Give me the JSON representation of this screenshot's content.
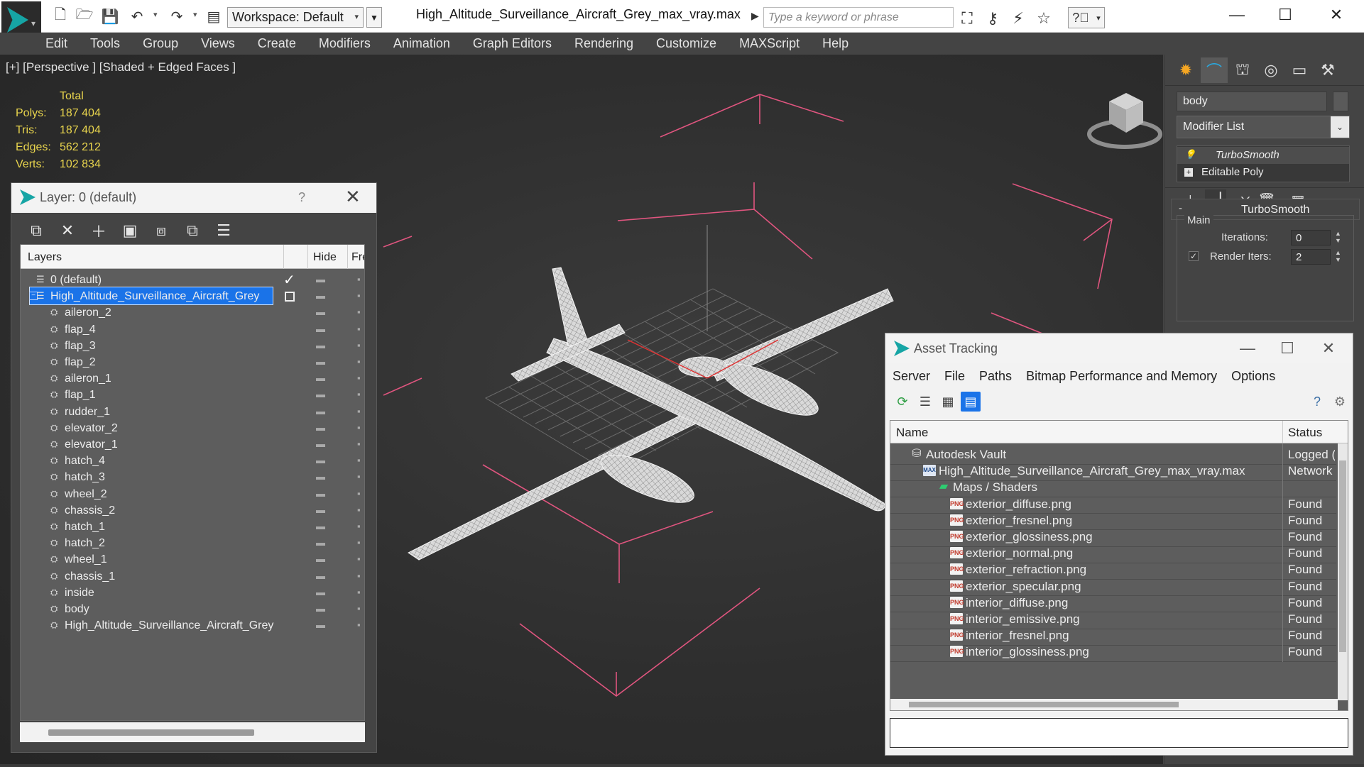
{
  "titlebar": {
    "workspace": "Workspace: Default",
    "file_title": "High_Altitude_Surveillance_Aircraft_Grey_max_vray.max",
    "search_placeholder": "Type a keyword or phrase",
    "minimize": "—",
    "maximize": "☐",
    "close": "✕"
  },
  "menubar": [
    "Edit",
    "Tools",
    "Group",
    "Views",
    "Create",
    "Modifiers",
    "Animation",
    "Graph Editors",
    "Rendering",
    "Customize",
    "MAXScript",
    "Help"
  ],
  "viewport": {
    "label": "[+] [Perspective ] [Shaded + Edged Faces ]",
    "stats_header": "Total",
    "stats": [
      {
        "label": "Polys:",
        "value": "187 404"
      },
      {
        "label": "Tris:",
        "value": "187 404"
      },
      {
        "label": "Edges:",
        "value": "562 212"
      },
      {
        "label": "Verts:",
        "value": "102 834"
      }
    ]
  },
  "layer_dialog": {
    "title": "Layer: 0 (default)",
    "help": "?",
    "close": "✕",
    "columns": {
      "layers": "Layers",
      "hide": "Hide",
      "freeze": "Fre"
    },
    "rows": [
      {
        "name": "0 (default)",
        "level": 0,
        "type": "layer",
        "active": true
      },
      {
        "name": "High_Altitude_Surveillance_Aircraft_Grey",
        "level": 0,
        "type": "layer",
        "selected": true
      },
      {
        "name": "aileron_2",
        "level": 1,
        "type": "object"
      },
      {
        "name": "flap_4",
        "level": 1,
        "type": "object"
      },
      {
        "name": "flap_3",
        "level": 1,
        "type": "object"
      },
      {
        "name": "flap_2",
        "level": 1,
        "type": "object"
      },
      {
        "name": "aileron_1",
        "level": 1,
        "type": "object"
      },
      {
        "name": "flap_1",
        "level": 1,
        "type": "object"
      },
      {
        "name": "rudder_1",
        "level": 1,
        "type": "object"
      },
      {
        "name": "elevator_2",
        "level": 1,
        "type": "object"
      },
      {
        "name": "elevator_1",
        "level": 1,
        "type": "object"
      },
      {
        "name": "hatch_4",
        "level": 1,
        "type": "object"
      },
      {
        "name": "hatch_3",
        "level": 1,
        "type": "object"
      },
      {
        "name": "wheel_2",
        "level": 1,
        "type": "object"
      },
      {
        "name": "chassis_2",
        "level": 1,
        "type": "object"
      },
      {
        "name": "hatch_1",
        "level": 1,
        "type": "object"
      },
      {
        "name": "hatch_2",
        "level": 1,
        "type": "object"
      },
      {
        "name": "wheel_1",
        "level": 1,
        "type": "object"
      },
      {
        "name": "chassis_1",
        "level": 1,
        "type": "object"
      },
      {
        "name": "inside",
        "level": 1,
        "type": "object"
      },
      {
        "name": "body",
        "level": 1,
        "type": "object"
      },
      {
        "name": "High_Altitude_Surveillance_Aircraft_Grey",
        "level": 1,
        "type": "object"
      }
    ]
  },
  "command_panel": {
    "object_name": "body",
    "modifier_list": "Modifier List",
    "stack": [
      {
        "name": "TurboSmooth",
        "kind": "turbo"
      },
      {
        "name": "Editable Poly",
        "kind": "base"
      }
    ],
    "rollout_title": "TurboSmooth",
    "rollout_toggle": "-",
    "group_label": "Main",
    "iterations_label": "Iterations:",
    "iterations_value": "0",
    "render_iters_label": "Render Iters:",
    "render_iters_value": "2",
    "render_iters_checked": "✓"
  },
  "asset_dialog": {
    "title": "Asset Tracking",
    "menu": [
      "Server",
      "File",
      "Paths",
      "Bitmap Performance and Memory",
      "Options"
    ],
    "columns": {
      "name": "Name",
      "status": "Status"
    },
    "rows": [
      {
        "name": "Autodesk Vault",
        "status": "Logged (",
        "level": 0,
        "icon": "vault"
      },
      {
        "name": "High_Altitude_Surveillance_Aircraft_Grey_max_vray.max",
        "status": "Network",
        "level": 1,
        "icon": "maxfile"
      },
      {
        "name": "Maps / Shaders",
        "status": "",
        "level": 2,
        "icon": "folder"
      },
      {
        "name": "exterior_diffuse.png",
        "status": "Found",
        "level": 3,
        "icon": "png"
      },
      {
        "name": "exterior_fresnel.png",
        "status": "Found",
        "level": 3,
        "icon": "png"
      },
      {
        "name": "exterior_glossiness.png",
        "status": "Found",
        "level": 3,
        "icon": "png"
      },
      {
        "name": "exterior_normal.png",
        "status": "Found",
        "level": 3,
        "icon": "png"
      },
      {
        "name": "exterior_refraction.png",
        "status": "Found",
        "level": 3,
        "icon": "png"
      },
      {
        "name": "exterior_specular.png",
        "status": "Found",
        "level": 3,
        "icon": "png"
      },
      {
        "name": "interior_diffuse.png",
        "status": "Found",
        "level": 3,
        "icon": "png"
      },
      {
        "name": "interior_emissive.png",
        "status": "Found",
        "level": 3,
        "icon": "png"
      },
      {
        "name": "interior_fresnel.png",
        "status": "Found",
        "level": 3,
        "icon": "png"
      },
      {
        "name": "interior_glossiness.png",
        "status": "Found",
        "level": 3,
        "icon": "png"
      }
    ],
    "png_icon_text": "PNG",
    "max_icon_text": "MAX"
  },
  "colors": {
    "accent": "#1a73e8",
    "stats_yellow": "#e8d44d",
    "gizmo_pink": "#e0557f",
    "viewport_bg": "#2e2e2e"
  }
}
